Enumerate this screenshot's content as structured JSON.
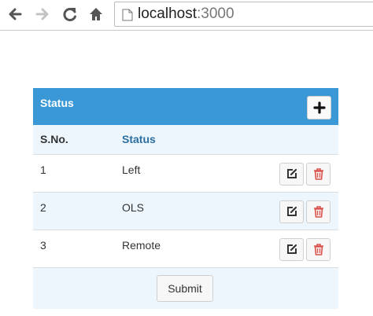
{
  "browser": {
    "url_host": "localhost",
    "url_port": ":3000",
    "icons": [
      "back-icon",
      "forward-icon",
      "reload-icon",
      "home-icon",
      "page-icon"
    ]
  },
  "panel": {
    "title": "Status",
    "add_icon": "plus-icon",
    "header_color": "#3a98d7"
  },
  "table": {
    "columns": [
      "S.No.",
      "Status"
    ],
    "rows": [
      {
        "sno": "1",
        "status": "Left"
      },
      {
        "sno": "2",
        "status": "OLS"
      },
      {
        "sno": "3",
        "status": "Remote"
      }
    ],
    "row_actions": [
      "edit-icon",
      "trash-icon"
    ]
  },
  "footer": {
    "submit_label": "Submit"
  }
}
